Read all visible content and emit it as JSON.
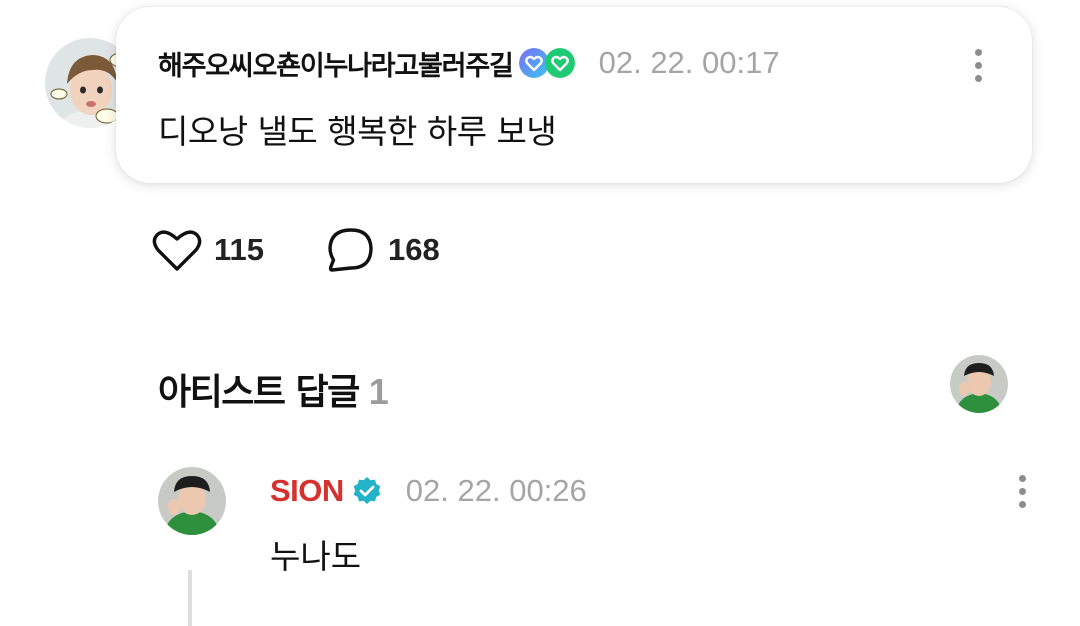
{
  "post": {
    "author": "해주오씨오쵼이누나라고불러주길",
    "timestamp": "02. 22. 00:17",
    "text": "디오낭 낼도 행복한 하루 보냉",
    "avatar_icon": "user-avatar",
    "badge_icons": [
      "membership-heart-badge-purple",
      "membership-heart-badge-green"
    ]
  },
  "actions": {
    "like_icon": "heart-icon",
    "like_count": "115",
    "comment_icon": "speech-bubble-icon",
    "comment_count": "168"
  },
  "artist_replies": {
    "title": "아티스트 답글",
    "count": "1",
    "avatar_icon": "artist-avatar"
  },
  "reply": {
    "author": "SION",
    "verified_icon": "verified-check-icon",
    "timestamp": "02. 22. 00:26",
    "text": "누나도"
  },
  "colors": {
    "artist_name": "#d5312e",
    "verified": "#22b3c9",
    "timestamp": "#a5a5a5",
    "muted": "#9c9c9c"
  }
}
